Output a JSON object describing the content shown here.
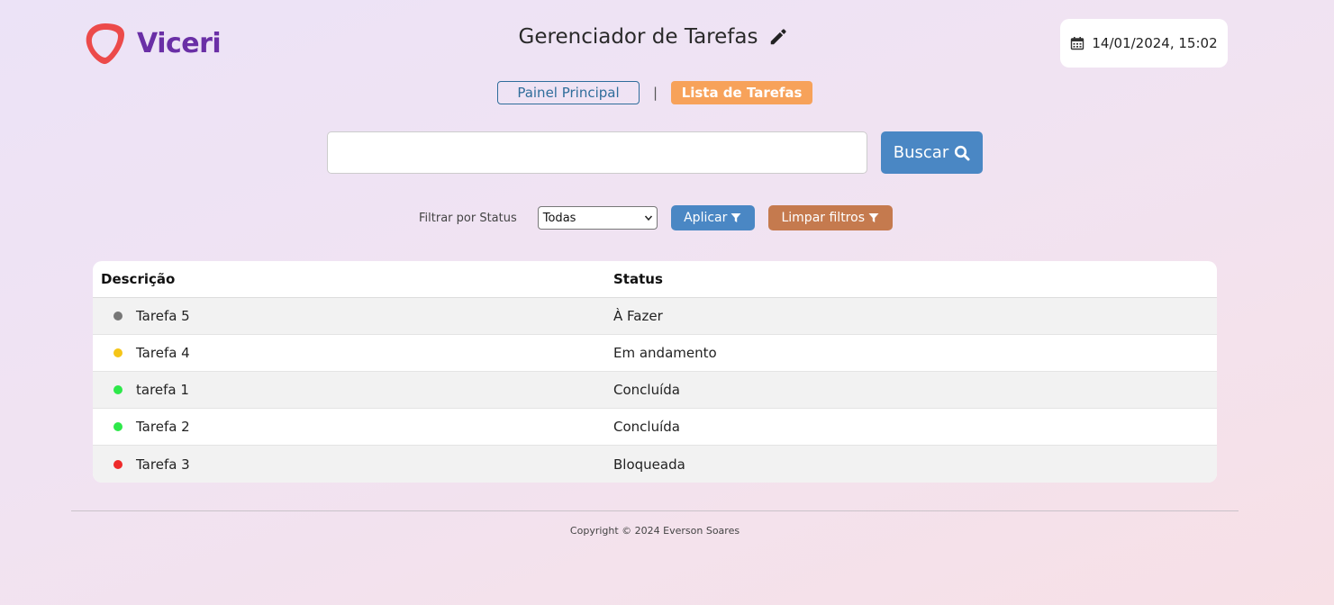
{
  "brand": {
    "name": "Viceri",
    "color": "#6a2fa6",
    "mark_color": "#ec4a4a"
  },
  "header": {
    "title": "Gerenciador de Tarefas",
    "datetime": "14/01/2024, 15:02"
  },
  "nav": {
    "items": [
      {
        "label": "Painel Principal",
        "active": false
      },
      {
        "label": "Lista de Tarefas",
        "active": true
      }
    ],
    "separator": "|"
  },
  "search": {
    "value": "",
    "placeholder": "",
    "button_label": "Buscar"
  },
  "filter": {
    "label": "Filtrar por Status",
    "selected": "Todas",
    "apply_label": "Aplicar",
    "clear_label": "Limpar filtros"
  },
  "table": {
    "columns": [
      "Descrição",
      "Status"
    ],
    "rows": [
      {
        "description": "Tarefa 5",
        "status": "À Fazer",
        "dot_color": "#777777"
      },
      {
        "description": "Tarefa 4",
        "status": "Em andamento",
        "dot_color": "#f5c518"
      },
      {
        "description": "tarefa 1",
        "status": "Concluída",
        "dot_color": "#2ee84a"
      },
      {
        "description": "Tarefa 2",
        "status": "Concluída",
        "dot_color": "#2ee84a"
      },
      {
        "description": "Tarefa 3",
        "status": "Bloqueada",
        "dot_color": "#ee2a2a"
      }
    ]
  },
  "footer": {
    "copyright": "Copyright © 2024 Everson Soares"
  },
  "colors": {
    "primary": "#4a87c4",
    "nav_active": "#f7a25a",
    "nav_outline": "#2f6d9b",
    "clear_button": "#c57a4e"
  }
}
